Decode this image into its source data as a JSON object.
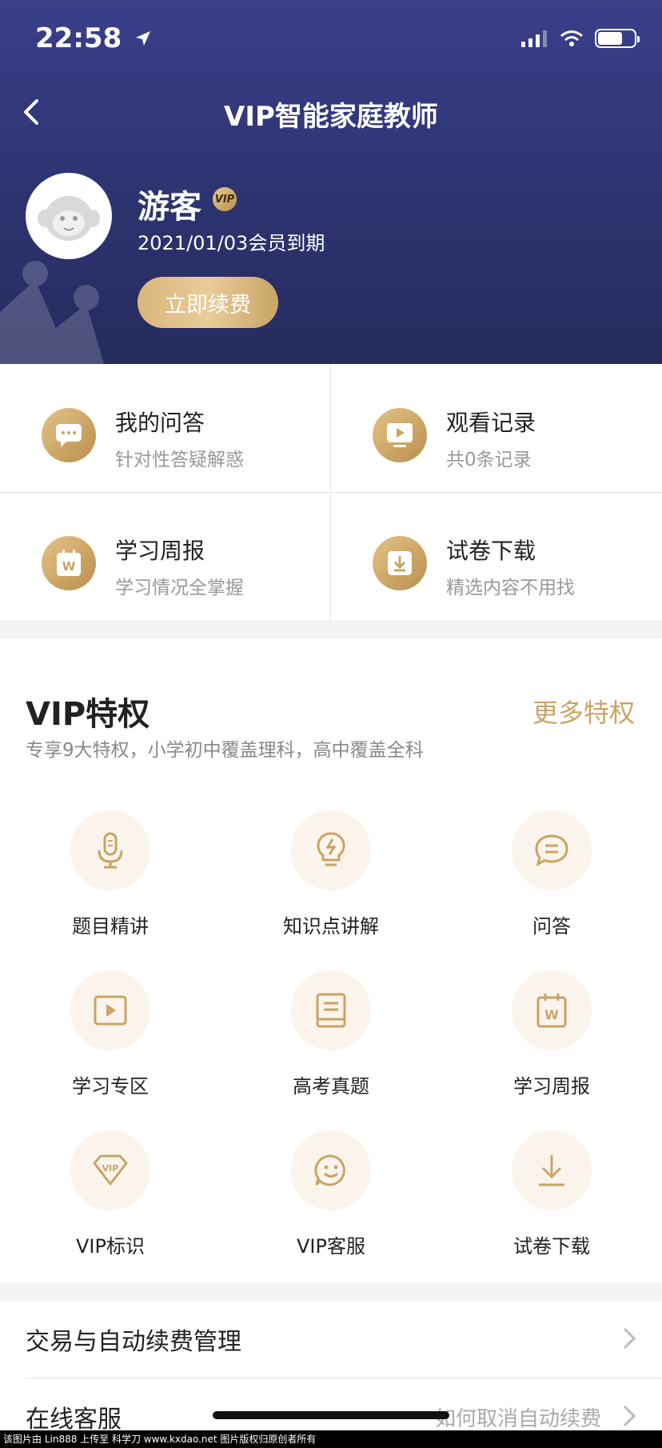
{
  "status_bar": {
    "time": "22:58"
  },
  "nav": {
    "title": "VIP智能家庭教师"
  },
  "profile": {
    "name": "游客",
    "badge": "VIP",
    "expire": "2021/01/03会员到期",
    "renew_label": "立即续费"
  },
  "quick": [
    {
      "title": "我的问答",
      "sub": "针对性答疑解惑",
      "icon": "chat-icon"
    },
    {
      "title": "观看记录",
      "sub": "共0条记录",
      "icon": "tv-play-icon"
    },
    {
      "title": "学习周报",
      "sub": "学习情况全掌握",
      "icon": "calendar-w-icon"
    },
    {
      "title": "试卷下载",
      "sub": "精选内容不用找",
      "icon": "download-icon"
    }
  ],
  "vip": {
    "title": "VIP特权",
    "more": "更多特权",
    "desc": "专享9大特权，小学初中覆盖理科，高中覆盖全科",
    "items": [
      {
        "label": "题目精讲",
        "icon": "microphone-icon"
      },
      {
        "label": "知识点讲解",
        "icon": "lightbulb-icon"
      },
      {
        "label": "问答",
        "icon": "message-icon"
      },
      {
        "label": "学习专区",
        "icon": "video-icon"
      },
      {
        "label": "高考真题",
        "icon": "book-icon"
      },
      {
        "label": "学习周报",
        "icon": "calendar-w-icon"
      },
      {
        "label": "VIP标识",
        "icon": "vip-diamond-icon"
      },
      {
        "label": "VIP客服",
        "icon": "smile-chat-icon"
      },
      {
        "label": "试卷下载",
        "icon": "download-icon"
      }
    ]
  },
  "list": [
    {
      "label": "交易与自动续费管理",
      "hint": ""
    },
    {
      "label": "在线客服",
      "hint": "如何取消自动续费"
    }
  ],
  "watermark": "该图片由 Lin888 上传至 科学刀 www.kxdao.net 图片版权归原创者所有",
  "colors": {
    "header": "#2f3574",
    "gold": "#c9a466",
    "gold_light": "#faf4ec"
  }
}
